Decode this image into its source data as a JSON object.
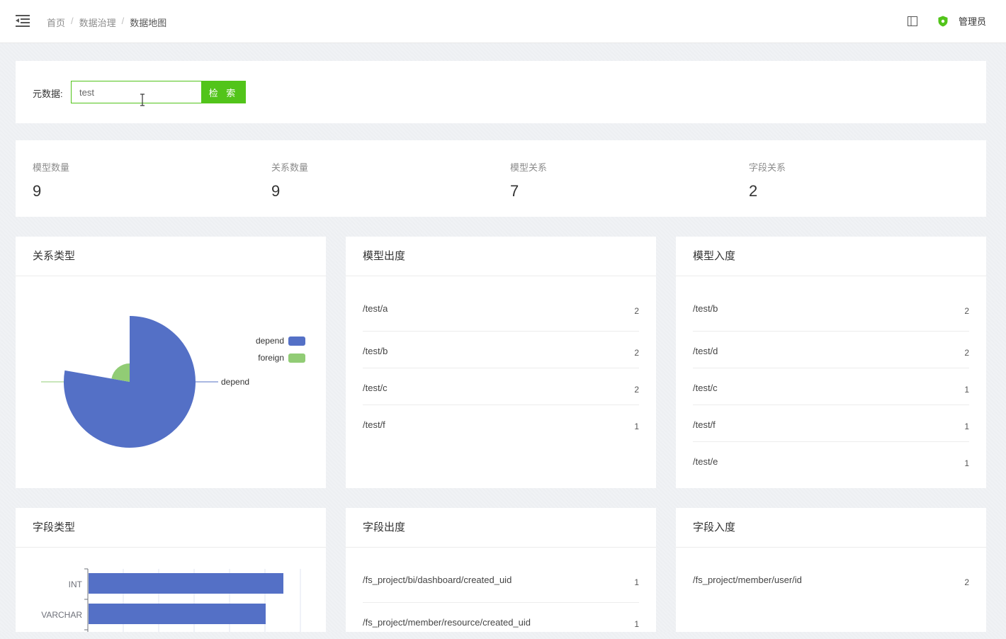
{
  "breadcrumb": [
    "首页",
    "数据治理",
    "数据地图"
  ],
  "header": {
    "user_label": "管理员"
  },
  "search": {
    "label": "元数据:",
    "value": "test",
    "button_label": "检 索"
  },
  "stats": [
    {
      "label": "模型数量",
      "value": "9"
    },
    {
      "label": "关系数量",
      "value": "9"
    },
    {
      "label": "模型关系",
      "value": "7"
    },
    {
      "label": "字段关系",
      "value": "2"
    }
  ],
  "relation_type": {
    "title": "关系类型",
    "chart_data": {
      "type": "pie",
      "roseType": true,
      "categories": [
        "depend",
        "foreign"
      ],
      "values": [
        7,
        2
      ],
      "colors": [
        "#5470c6",
        "#91cc75"
      ],
      "legend_position": "top-right",
      "slice_labels": [
        "depend",
        "foreign"
      ]
    }
  },
  "model_out": {
    "title": "模型出度",
    "rows": [
      {
        "name": "/test/a",
        "count": "2"
      },
      {
        "name": "/test/b",
        "count": "2"
      },
      {
        "name": "/test/c",
        "count": "2"
      },
      {
        "name": "/test/f",
        "count": "1"
      }
    ]
  },
  "model_in": {
    "title": "模型入度",
    "rows": [
      {
        "name": "/test/b",
        "count": "2"
      },
      {
        "name": "/test/d",
        "count": "2"
      },
      {
        "name": "/test/c",
        "count": "1"
      },
      {
        "name": "/test/f",
        "count": "1"
      },
      {
        "name": "/test/e",
        "count": "1"
      }
    ]
  },
  "field_type": {
    "title": "字段类型",
    "chart_data": {
      "type": "bar",
      "orientation": "horizontal",
      "categories": [
        "INT",
        "VARCHAR"
      ],
      "values": [
        5.5,
        5
      ],
      "xlim": [
        0,
        6
      ],
      "color": "#5470c6",
      "grid": true
    }
  },
  "field_out": {
    "title": "字段出度",
    "rows": [
      {
        "name": "/fs_project/bi/dashboard/created_uid",
        "count": "1"
      },
      {
        "name": "/fs_project/member/resource/created_uid",
        "count": "1"
      }
    ]
  },
  "field_in": {
    "title": "字段入度",
    "rows": [
      {
        "name": "/fs_project/member/user/id",
        "count": "2"
      }
    ]
  }
}
